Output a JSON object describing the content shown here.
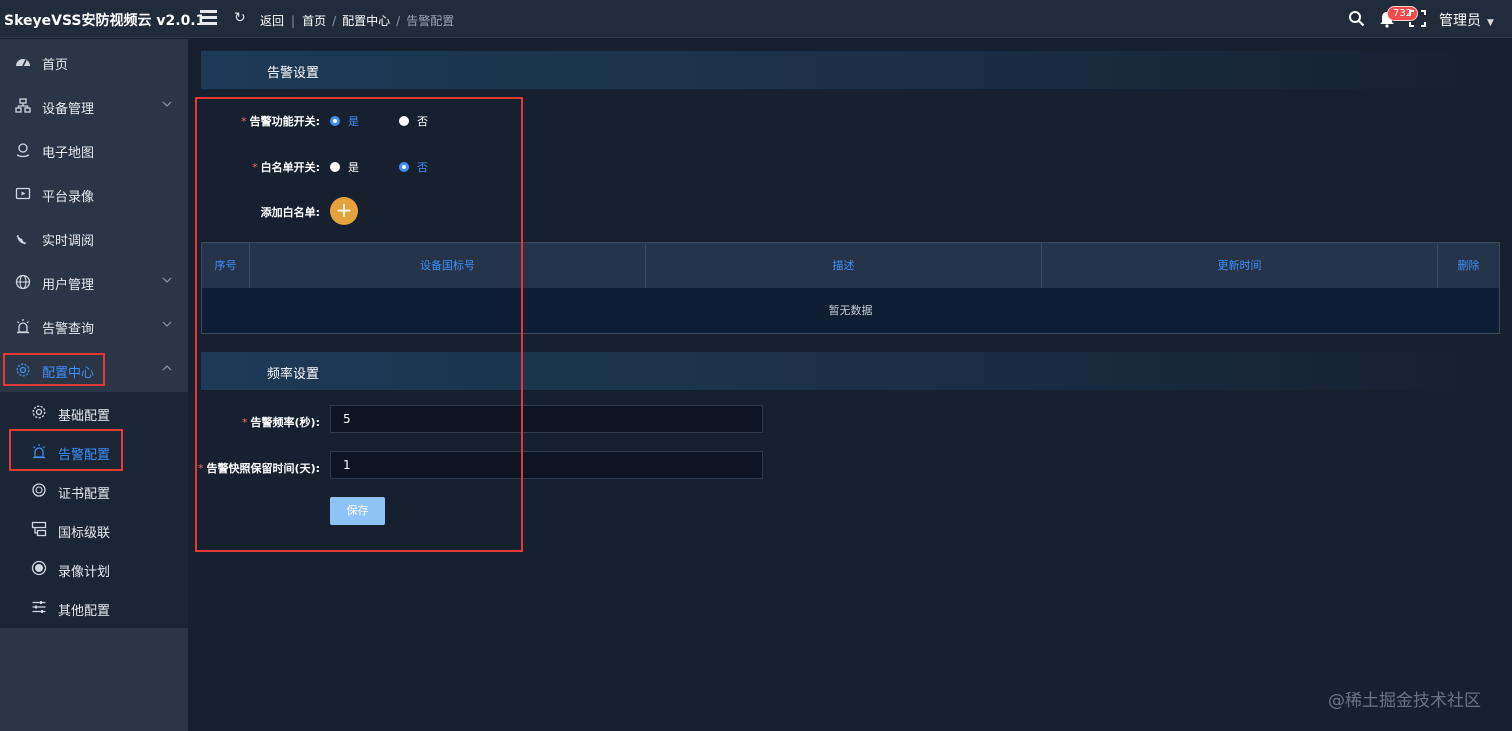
{
  "app": {
    "title": "SkeyeVSS安防视频云 v2.0.1"
  },
  "breadcrumb": {
    "back": "返回",
    "home": "首页",
    "section": "配置中心",
    "current": "告警配置"
  },
  "header": {
    "badge_count": "732",
    "user": "管理员"
  },
  "sidebar": {
    "items": [
      {
        "label": "首页",
        "icon": "dashboard-icon"
      },
      {
        "label": "设备管理",
        "icon": "device-tree-icon"
      },
      {
        "label": "电子地图",
        "icon": "map-pin-icon"
      },
      {
        "label": "平台录像",
        "icon": "video-icon"
      },
      {
        "label": "实时调阅",
        "icon": "satellite-icon"
      },
      {
        "label": "用户管理",
        "icon": "globe-icon"
      },
      {
        "label": "告警查询",
        "icon": "alarm-icon"
      },
      {
        "label": "配置中心",
        "icon": "gear-icon"
      }
    ],
    "subitems": [
      {
        "label": "基础配置",
        "icon": "gear-icon"
      },
      {
        "label": "告警配置",
        "icon": "alarm-icon"
      },
      {
        "label": "证书配置",
        "icon": "certificate-icon"
      },
      {
        "label": "国标级联",
        "icon": "cascade-icon"
      },
      {
        "label": "录像计划",
        "icon": "record-icon"
      },
      {
        "label": "其他配置",
        "icon": "sliders-icon"
      }
    ]
  },
  "alarm_settings": {
    "title": "告警设置",
    "alarm_switch": {
      "label": "告警功能开关:",
      "yes": "是",
      "no": "否",
      "selected": "是"
    },
    "whitelist_switch": {
      "label": "白名单开关:",
      "yes": "是",
      "no": "否",
      "selected": "否"
    },
    "add_whitelist_label": "添加白名单:",
    "table": {
      "columns": [
        "序号",
        "设备国标号",
        "描述",
        "更新时间",
        "删除"
      ],
      "empty_text": "暂无数据"
    }
  },
  "frequency_settings": {
    "title": "频率设置",
    "alarm_frequency": {
      "label": "告警频率(秒):",
      "value": "5"
    },
    "snapshot_retention": {
      "label": "告警快照保留时间(天):",
      "value": "1"
    },
    "save_label": "保存"
  },
  "watermark": "@稀土掘金技术社区",
  "colors": {
    "accent": "#3e8ff5",
    "highlight_box": "#e53935",
    "add_button": "#e6a23c",
    "save_button": "#8fc3f7"
  }
}
